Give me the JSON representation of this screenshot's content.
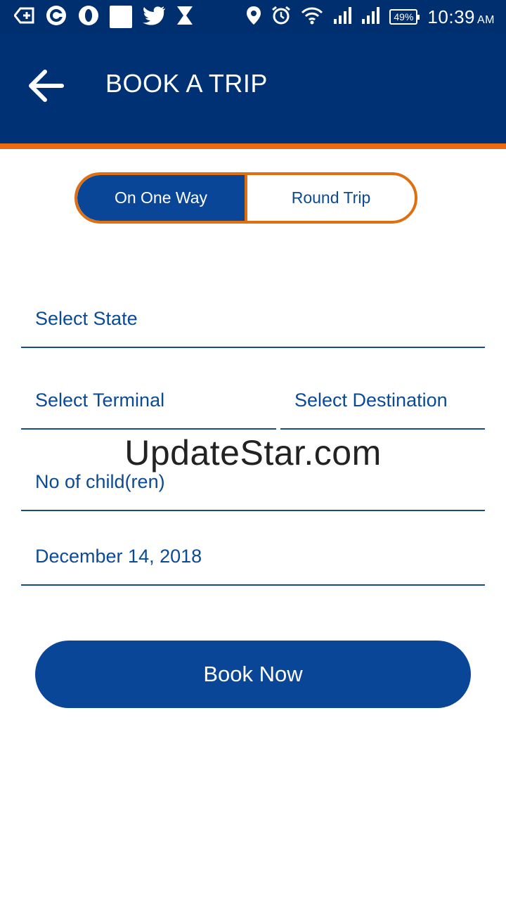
{
  "status_bar": {
    "battery": "49%",
    "time": "10:39",
    "ampm": "AM"
  },
  "header": {
    "title": "BOOK A TRIP"
  },
  "trip_toggle": {
    "one_way_label": "On One Way",
    "round_trip_label": "Round Trip",
    "selected": "On One Way"
  },
  "form": {
    "state_placeholder": "Select State",
    "terminal_placeholder": "Select Terminal",
    "destination_placeholder": "Select Destination",
    "children_placeholder": "No of child(ren)",
    "date_value": "December 14, 2018"
  },
  "watermark": "UpdateStar.com",
  "actions": {
    "book_now_label": "Book Now"
  },
  "colors": {
    "primary": "#003174",
    "button": "#0a4697",
    "accent": "#ee6a12",
    "text": "#0b4a95"
  }
}
